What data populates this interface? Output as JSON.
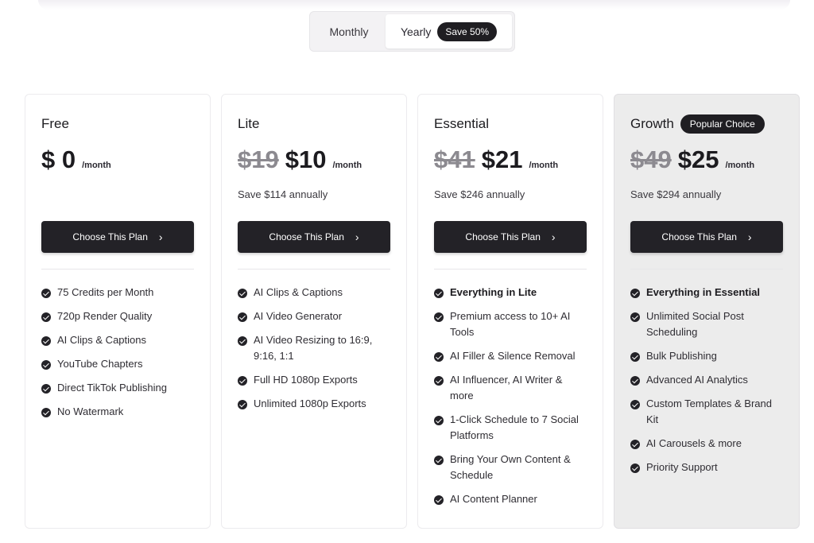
{
  "billing_toggle": {
    "monthly_label": "Monthly",
    "yearly_label": "Yearly",
    "save_badge": "Save 50%",
    "selected": "Yearly"
  },
  "plans": [
    {
      "name": "Free",
      "badge": "",
      "old_price": "",
      "price": "$ 0",
      "per": "/month",
      "save_note": "",
      "cta": "Choose This Plan",
      "features": [
        {
          "text": "75 Credits per Month",
          "bold": false
        },
        {
          "text": "720p Render Quality",
          "bold": false
        },
        {
          "text": "AI Clips & Captions",
          "bold": false
        },
        {
          "text": "YouTube Chapters",
          "bold": false
        },
        {
          "text": "Direct TikTok Publishing",
          "bold": false
        },
        {
          "text": "No Watermark",
          "bold": false
        }
      ]
    },
    {
      "name": "Lite",
      "badge": "",
      "old_price": "$19",
      "price": "$10",
      "per": "/month",
      "save_note": "Save $114 annually",
      "cta": "Choose This Plan",
      "features": [
        {
          "text": "AI Clips & Captions",
          "bold": false
        },
        {
          "text": "AI Video Generator",
          "bold": false
        },
        {
          "text": "AI Video Resizing to 16:9, 9:16, 1:1",
          "bold": false
        },
        {
          "text": "Full HD 1080p Exports",
          "bold": false
        },
        {
          "text": "Unlimited 1080p Exports",
          "bold": false
        }
      ]
    },
    {
      "name": "Essential",
      "badge": "",
      "old_price": "$41",
      "price": "$21",
      "per": "/month",
      "save_note": "Save $246 annually",
      "cta": "Choose This Plan",
      "features": [
        {
          "text": "Everything in Lite",
          "bold": true
        },
        {
          "text": "Premium access to 10+ AI Tools",
          "bold": false
        },
        {
          "text": "AI Filler & Silence Removal",
          "bold": false
        },
        {
          "text": "AI Influencer, AI Writer & more",
          "bold": false
        },
        {
          "text": "1-Click Schedule to 7 Social Platforms",
          "bold": false
        },
        {
          "text": "Bring Your Own Content & Schedule",
          "bold": false
        },
        {
          "text": "AI Content Planner",
          "bold": false
        }
      ]
    },
    {
      "name": "Growth",
      "badge": "Popular Choice",
      "old_price": "$49",
      "price": "$25",
      "per": "/month",
      "save_note": "Save $294 annually",
      "cta": "Choose This Plan",
      "features": [
        {
          "text": "Everything in Essential",
          "bold": true
        },
        {
          "text": "Unlimited Social Post Scheduling",
          "bold": false
        },
        {
          "text": "Bulk Publishing",
          "bold": false
        },
        {
          "text": "Advanced AI Analytics",
          "bold": false
        },
        {
          "text": "Custom Templates & Brand Kit",
          "bold": false
        },
        {
          "text": "AI Carousels & more",
          "bold": false
        },
        {
          "text": "Priority Support",
          "bold": false
        }
      ]
    }
  ],
  "colors": {
    "button_bg": "#232227",
    "popular_card_bg": "#ececec",
    "badge_bg": "#1f1e22"
  },
  "icons": {
    "feature_bullet": "check-circle-icon",
    "cta_arrow": "chevron-right-icon"
  }
}
